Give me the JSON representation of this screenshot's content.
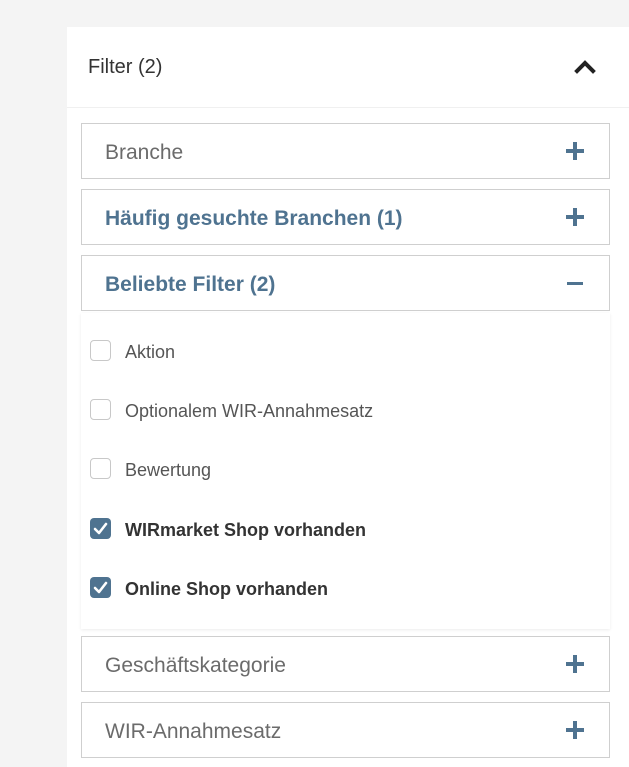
{
  "filter": {
    "title": "Filter (2)",
    "collapse_icon": "chevron-up-icon",
    "sections": [
      {
        "label": "Branche",
        "icon": "plus-icon",
        "bold": false
      },
      {
        "label": "Häufig gesuchte Branchen (1)",
        "icon": "plus-icon",
        "bold": true
      },
      {
        "label": "Beliebte Filter (2)",
        "icon": "minus-icon",
        "bold": true
      },
      {
        "label": "Geschäftskategorie",
        "icon": "plus-icon",
        "bold": false
      },
      {
        "label": "WIR-Annahmesatz",
        "icon": "plus-icon",
        "bold": false
      }
    ],
    "options": [
      {
        "label": "Aktion",
        "checked": false
      },
      {
        "label": "Optionalem WIR-Annahmesatz",
        "checked": false
      },
      {
        "label": "Bewertung",
        "checked": false
      },
      {
        "label": "WIRmarket Shop vorhanden",
        "checked": true
      },
      {
        "label": "Online Shop vorhanden",
        "checked": true
      }
    ]
  },
  "colors": {
    "accent": "#4f7390",
    "border": "#cfcfcf",
    "text": "#6b6b6b",
    "background": "#f4f4f4"
  }
}
